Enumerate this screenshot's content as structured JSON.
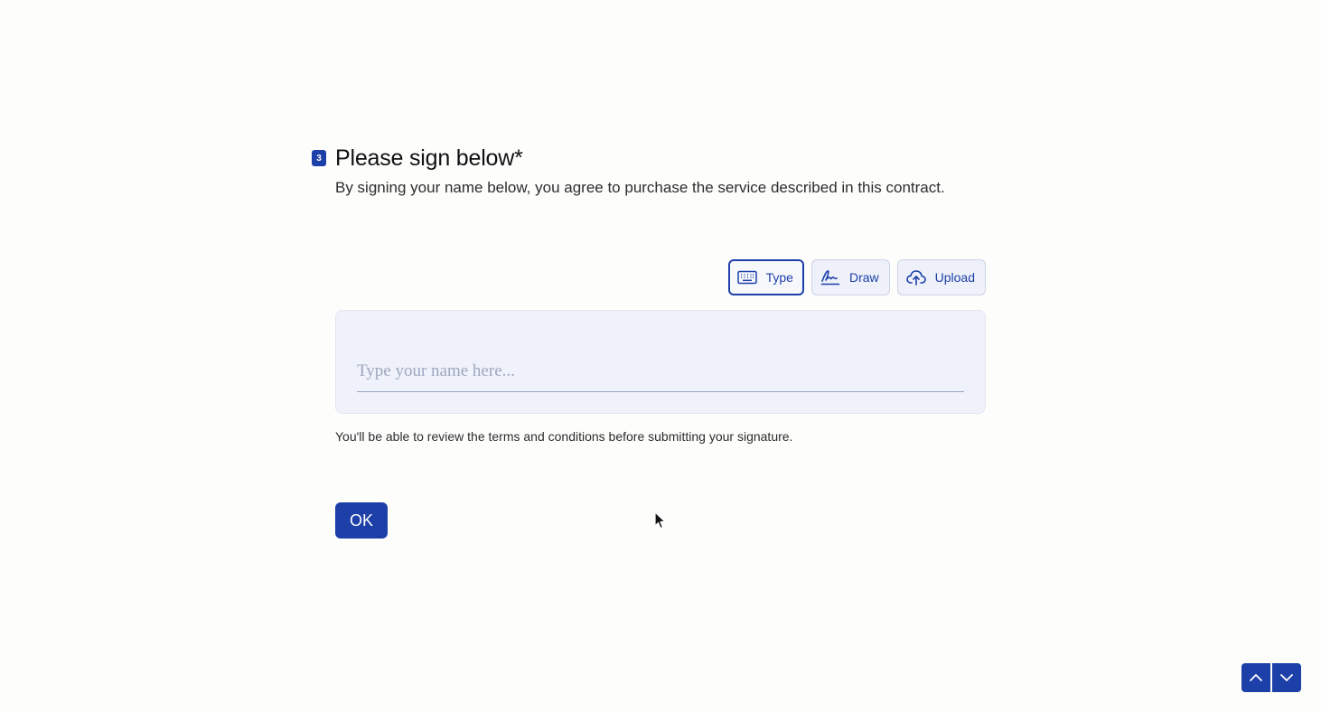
{
  "question": {
    "number": "3",
    "title": "Please sign below*",
    "description": "By signing your name below, you agree to purchase the service described in this contract."
  },
  "signature_modes": [
    {
      "label": "Type",
      "icon": "keyboard-icon",
      "active": true
    },
    {
      "label": "Draw",
      "icon": "signature-pen-icon",
      "active": false
    },
    {
      "label": "Upload",
      "icon": "cloud-upload-icon",
      "active": false
    }
  ],
  "signature_input": {
    "placeholder": "Type your name here...",
    "value": ""
  },
  "terms_note": "You'll be able to review the terms and conditions before submitting your signature.",
  "ok_button": "OK",
  "colors": {
    "accent": "#1c3fa8",
    "box_background": "#eff2fa",
    "page_background": "#fdfdfc"
  }
}
